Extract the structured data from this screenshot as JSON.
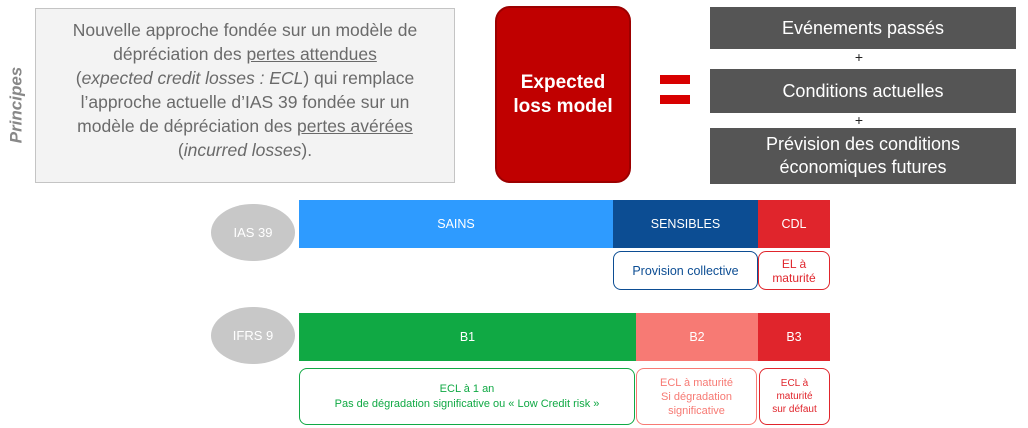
{
  "principes_label": "Principes",
  "intro": {
    "line1": "Nouvelle approche fondée sur un modèle de",
    "line2_pre": "dépréciation des ",
    "line2_u": "pertes attendues",
    "line3_open": "(",
    "line3_i": "expected credit losses : ECL",
    "line3_close": ") qui remplace",
    "line4": "l’approche actuelle d’IAS 39 fondée sur un",
    "line5_pre": "modèle de dépréciation des ",
    "line5_u": "pertes avérées",
    "line6_open": "(",
    "line6_i": "incurred losses",
    "line6_close": ")."
  },
  "expected_loss": {
    "line1": "Expected",
    "line2": "loss model"
  },
  "components": {
    "c1": "Evénements passés",
    "plus1": "+",
    "c2": "Conditions actuelles",
    "plus2": "+",
    "c3_line1": "Prévision des conditions",
    "c3_line2": "économiques futures"
  },
  "ias39": {
    "label": "IAS 39",
    "sains": "SAINS",
    "sensibles": "SENSIBLES",
    "cdl": "CDL",
    "provision": "Provision collective",
    "el_line1": "EL à",
    "el_line2": "maturité"
  },
  "ifrs9": {
    "label": "IFRS 9",
    "b1": "B1",
    "b2": "B2",
    "b3": "B3",
    "b1_desc_line1": "ECL à 1 an",
    "b1_desc_line2": "Pas de dégradation significative ou « Low Credit risk »",
    "b2_desc_line1": "ECL à maturité",
    "b2_desc_line2": "Si dégradation",
    "b2_desc_line3": "significative",
    "b3_desc_line1": "ECL à",
    "b3_desc_line2": "maturité",
    "b3_desc_line3": "sur défaut"
  },
  "colors": {
    "sains": "#2e9bff",
    "sensibles": "#0c4d93",
    "cdl_b3": "#e0252c",
    "b1": "#10a944",
    "b2": "#f77a74",
    "expected_loss": "#c00000",
    "grey_box": "#555555"
  }
}
